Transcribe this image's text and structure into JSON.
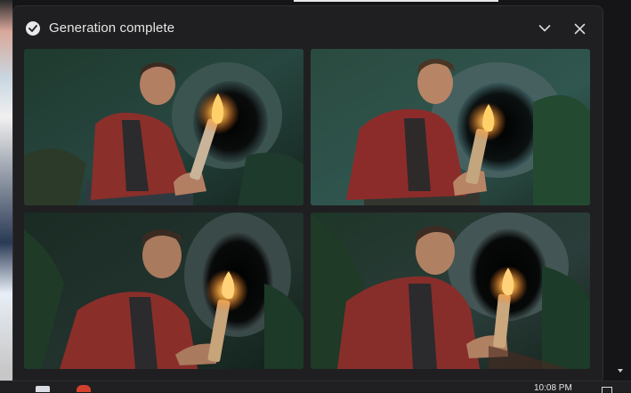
{
  "dialog": {
    "title": "Generation complete",
    "status_icon": "check-circle-icon",
    "collapse_icon": "chevron-down-icon",
    "close_icon": "close-icon"
  },
  "images": [
    {
      "alt": "generated-image-1"
    },
    {
      "alt": "generated-image-2"
    },
    {
      "alt": "generated-image-3"
    },
    {
      "alt": "generated-image-4"
    }
  ],
  "taskbar": {
    "clock": "10:08 PM"
  },
  "colors": {
    "panel_bg": "#1f1f21",
    "text": "#e6e6e6",
    "accent_shirt": "#8a2f2a",
    "flame": "#ffb347"
  }
}
